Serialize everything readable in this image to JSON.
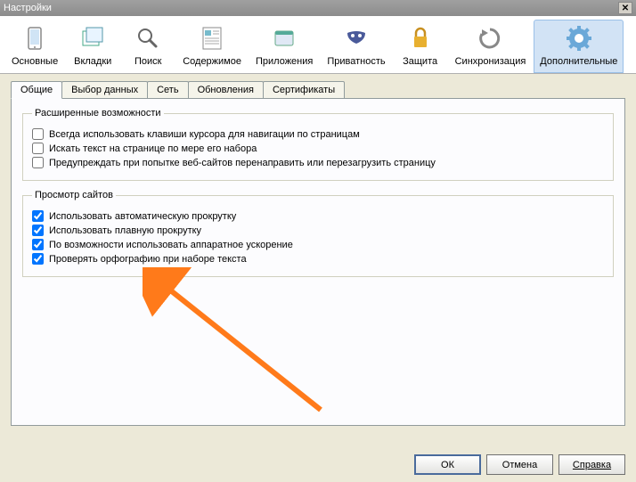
{
  "window": {
    "title": "Настройки"
  },
  "toolbar": {
    "items": [
      {
        "label": "Основные"
      },
      {
        "label": "Вкладки"
      },
      {
        "label": "Поиск"
      },
      {
        "label": "Содержимое"
      },
      {
        "label": "Приложения"
      },
      {
        "label": "Приватность"
      },
      {
        "label": "Защита"
      },
      {
        "label": "Синхронизация"
      },
      {
        "label": "Дополнительные"
      }
    ],
    "active_index": 8
  },
  "subtabs": {
    "items": [
      {
        "label": "Общие"
      },
      {
        "label": "Выбор данных"
      },
      {
        "label": "Сеть"
      },
      {
        "label": "Обновления"
      },
      {
        "label": "Сертификаты"
      }
    ],
    "active_index": 0
  },
  "groups": {
    "advanced": {
      "legend": "Расширенные возможности",
      "options": [
        {
          "label": "Всегда использовать клавиши курсора для навигации по страницам",
          "checked": false
        },
        {
          "label": "Искать текст на странице по мере его набора",
          "checked": false
        },
        {
          "label": "Предупреждать при попытке веб-сайтов перенаправить или перезагрузить страницу",
          "checked": false
        }
      ]
    },
    "browsing": {
      "legend": "Просмотр сайтов",
      "options": [
        {
          "label": "Использовать автоматическую прокрутку",
          "checked": true
        },
        {
          "label": "Использовать плавную прокрутку",
          "checked": true
        },
        {
          "label": "По возможности использовать аппаратное ускорение",
          "checked": true
        },
        {
          "label": "Проверять орфографию при наборе текста",
          "checked": true
        }
      ]
    }
  },
  "buttons": {
    "ok": "ОК",
    "cancel": "Отмена",
    "help": "Справка"
  }
}
